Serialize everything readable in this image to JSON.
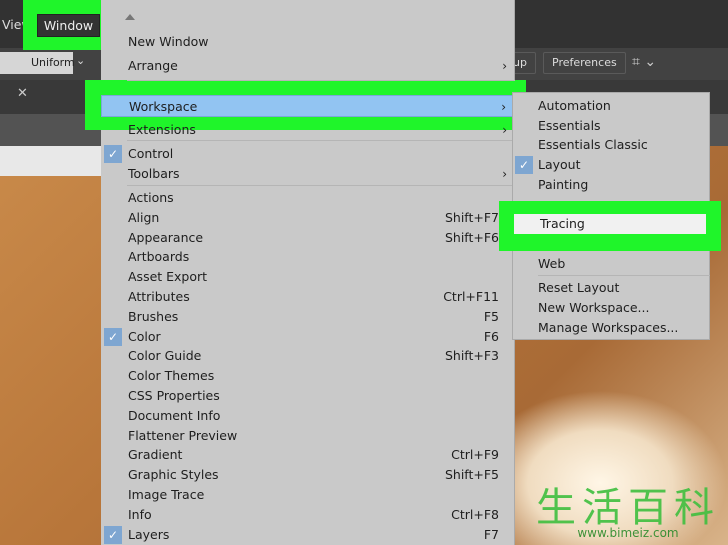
{
  "menubar": {
    "view_label": "View",
    "window_label": "Window"
  },
  "control_bar": {
    "stroke_label": "Uniform",
    "setup_label": "up",
    "preferences_label": "Preferences"
  },
  "window_menu": {
    "items": [
      {
        "label": "New Window"
      },
      {
        "label": "Arrange",
        "submenu": true
      },
      {
        "label": "Workspace",
        "submenu": true,
        "highlighted": true
      },
      {
        "label": "Extensions",
        "submenu": true
      },
      {
        "label": "Control",
        "checked": true
      },
      {
        "label": "Toolbars",
        "submenu": true
      },
      {
        "label": "Actions"
      },
      {
        "label": "Align",
        "shortcut": "Shift+F7"
      },
      {
        "label": "Appearance",
        "shortcut": "Shift+F6"
      },
      {
        "label": "Artboards"
      },
      {
        "label": "Asset Export"
      },
      {
        "label": "Attributes",
        "shortcut": "Ctrl+F11"
      },
      {
        "label": "Brushes",
        "shortcut": "F5"
      },
      {
        "label": "Color",
        "shortcut": "F6",
        "checked": true
      },
      {
        "label": "Color Guide",
        "shortcut": "Shift+F3"
      },
      {
        "label": "Color Themes"
      },
      {
        "label": "CSS Properties"
      },
      {
        "label": "Document Info"
      },
      {
        "label": "Flattener Preview"
      },
      {
        "label": "Gradient",
        "shortcut": "Ctrl+F9"
      },
      {
        "label": "Graphic Styles",
        "shortcut": "Shift+F5"
      },
      {
        "label": "Image Trace"
      },
      {
        "label": "Info",
        "shortcut": "Ctrl+F8"
      },
      {
        "label": "Layers",
        "shortcut": "F7",
        "checked": true
      }
    ]
  },
  "workspace_submenu": {
    "items": [
      {
        "label": "Automation"
      },
      {
        "label": "Essentials"
      },
      {
        "label": "Essentials Classic"
      },
      {
        "label": "Layout",
        "checked": true
      },
      {
        "label": "Painting"
      },
      {
        "label": ""
      },
      {
        "label": "Tracing",
        "highlighted": true
      },
      {
        "label": ""
      },
      {
        "label": "Web"
      },
      {
        "label": "Reset Layout"
      },
      {
        "label": "New Workspace..."
      },
      {
        "label": "Manage Workspaces..."
      }
    ]
  },
  "watermark": {
    "text": "生活百科",
    "url": "www.bimeiz.com"
  },
  "colors": {
    "highlight_green": "#1ff52a",
    "menu_selection": "#92c4f2",
    "check_bg": "#7ea6d1"
  }
}
